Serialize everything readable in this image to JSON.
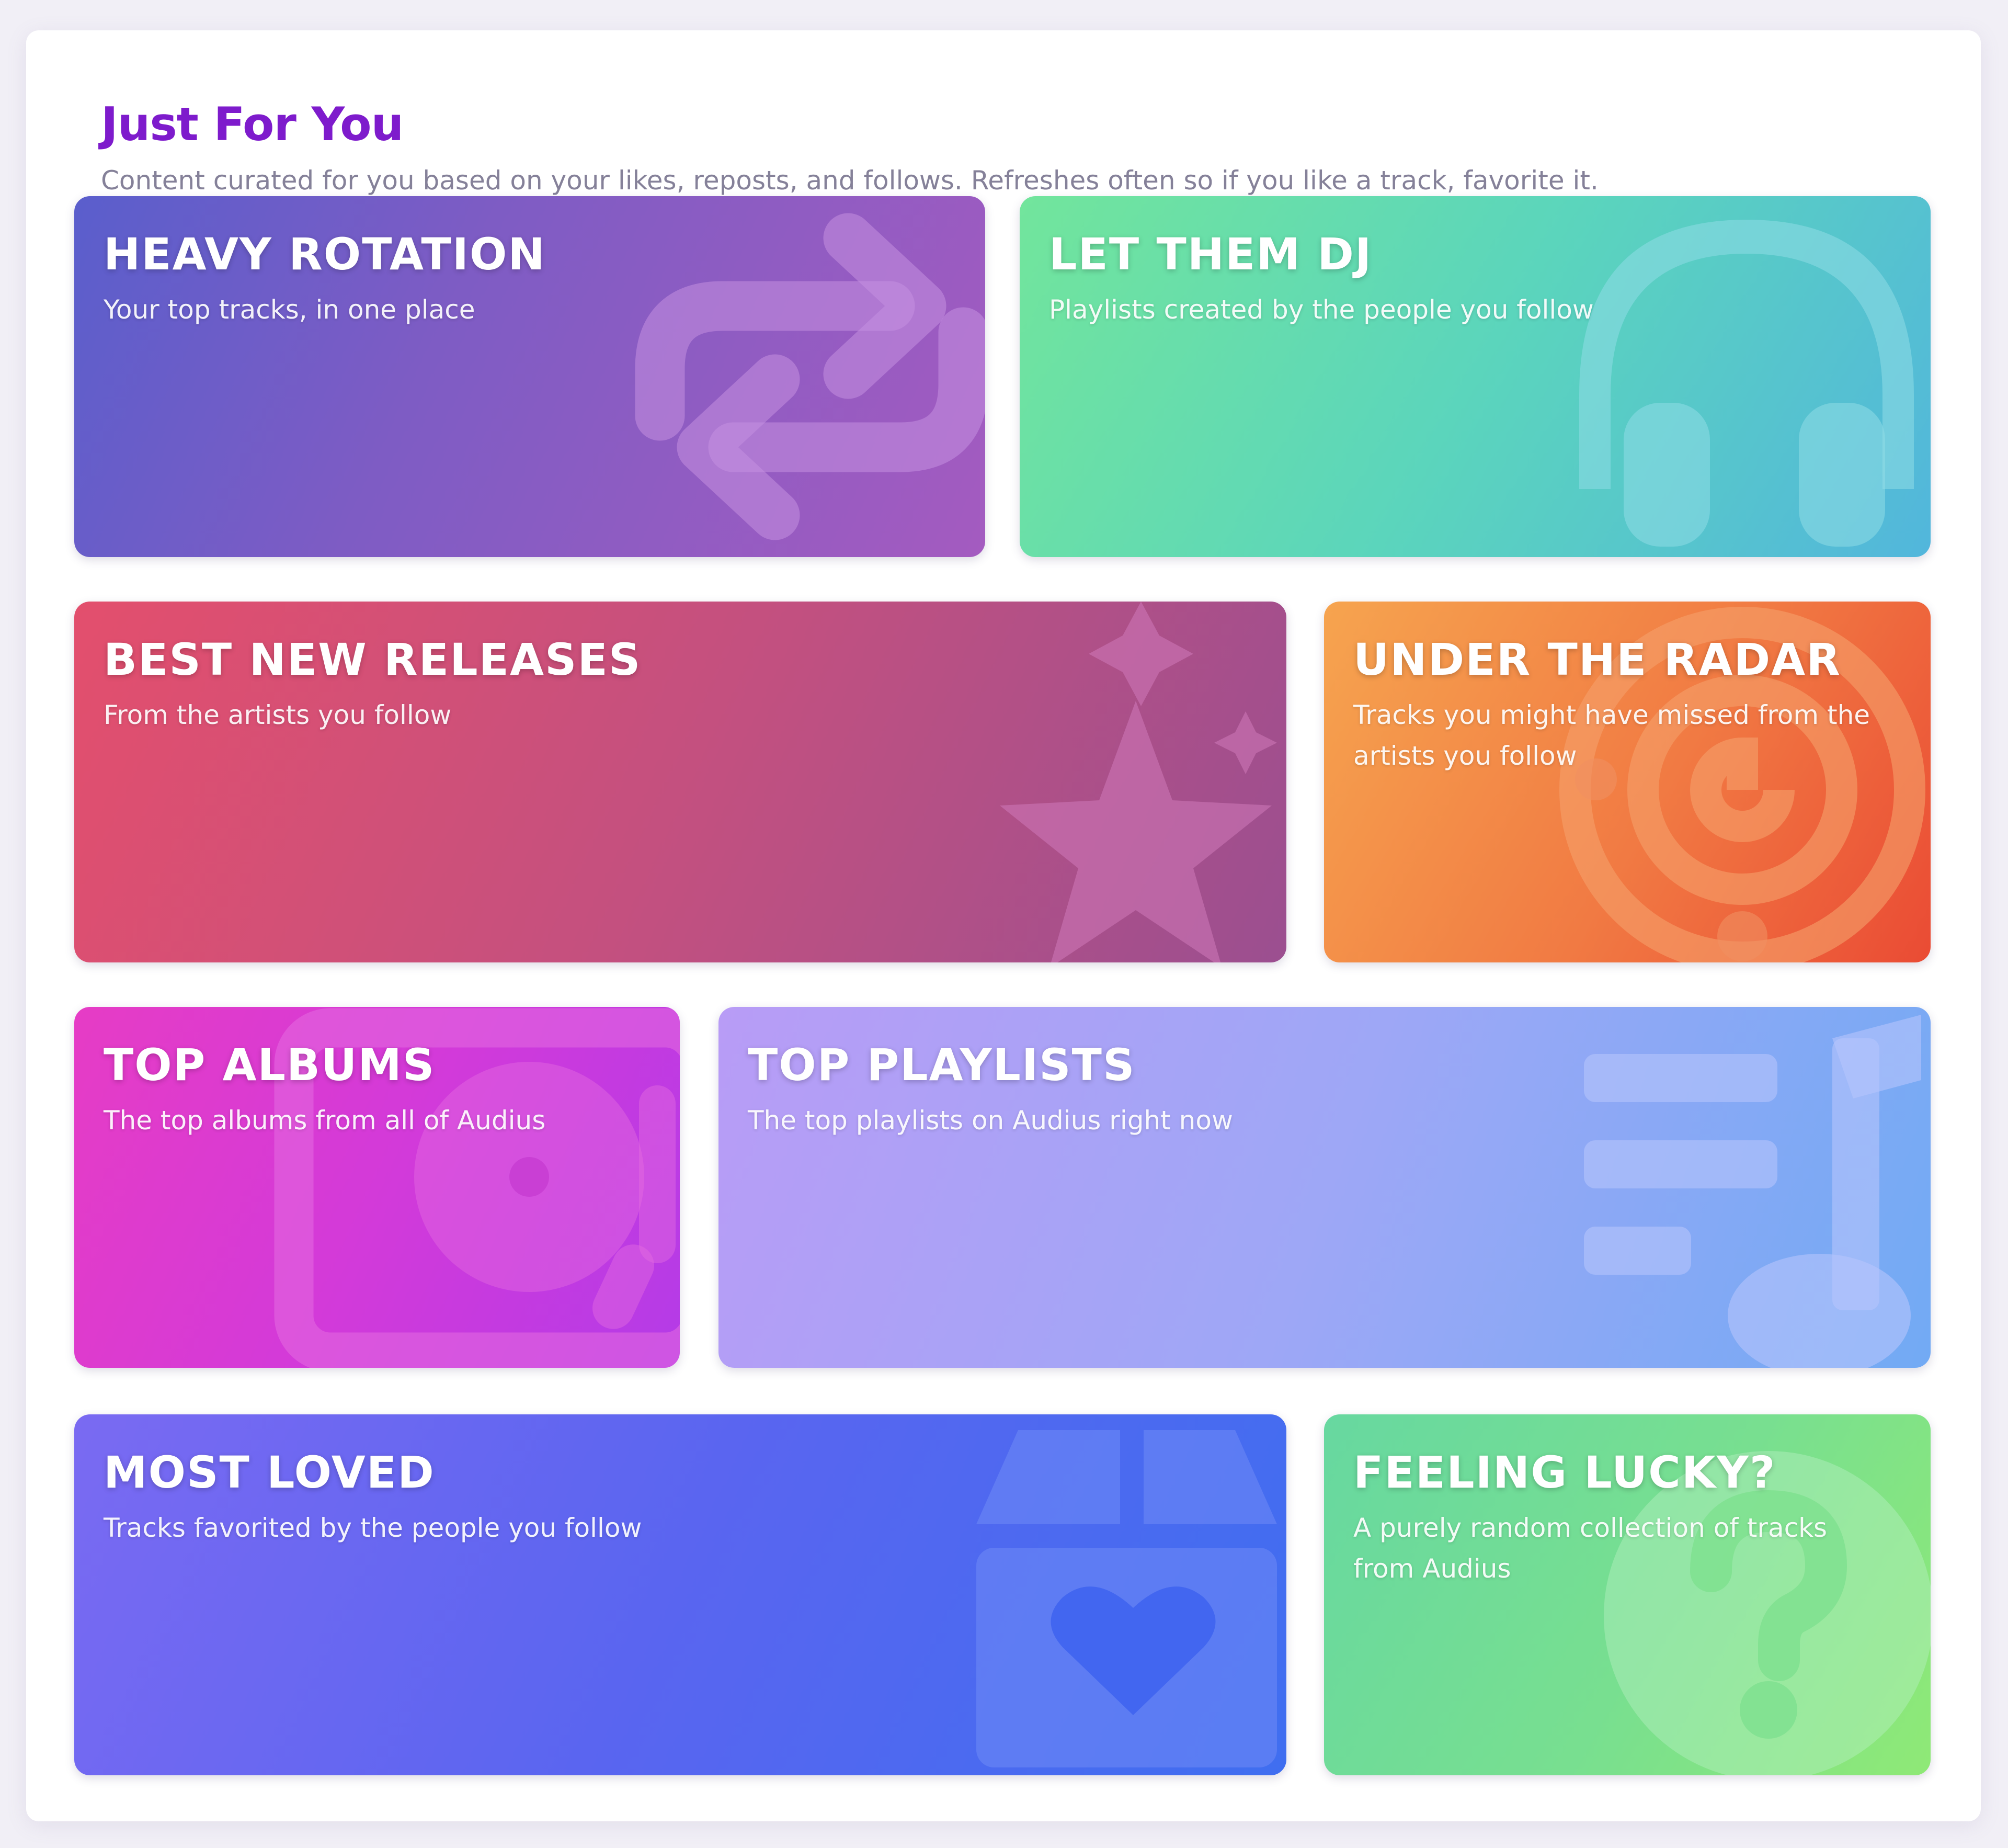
{
  "section": {
    "title": "Just For You",
    "subtitle": "Content curated for you based on your likes, reposts, and follows. Refreshes often so if you like a track, favorite it."
  },
  "cards": {
    "heavy_rotation": {
      "title": "HEAVY ROTATION",
      "desc": "Your top tracks, in one place",
      "icon": "repeat-icon"
    },
    "let_them_dj": {
      "title": "LET THEM DJ",
      "desc": "Playlists created by the people you follow",
      "icon": "headphones-icon"
    },
    "best_new_releases": {
      "title": "BEST NEW RELEASES",
      "desc": "From the artists you follow",
      "icon": "stars-icon"
    },
    "under_the_radar": {
      "title": "UNDER THE RADAR",
      "desc": "Tracks you might have missed from the artists you follow",
      "icon": "radar-icon"
    },
    "top_albums": {
      "title": "TOP ALBUMS",
      "desc": "The top albums from all of Audius",
      "icon": "turntable-icon"
    },
    "top_playlists": {
      "title": "TOP PLAYLISTS",
      "desc": "The top playlists on Audius right now",
      "icon": "playlist-note-icon"
    },
    "most_loved": {
      "title": "MOST LOVED",
      "desc": "Tracks favorited by the people you follow",
      "icon": "heart-box-icon"
    },
    "feeling_lucky": {
      "title": "FEELING LUCKY?",
      "desc": "A purely random collection of tracks from Audius",
      "icon": "question-circle-icon"
    }
  },
  "colors": {
    "title": "#7e1bcc",
    "subtitle": "#858199",
    "background": "#f1eff6"
  }
}
